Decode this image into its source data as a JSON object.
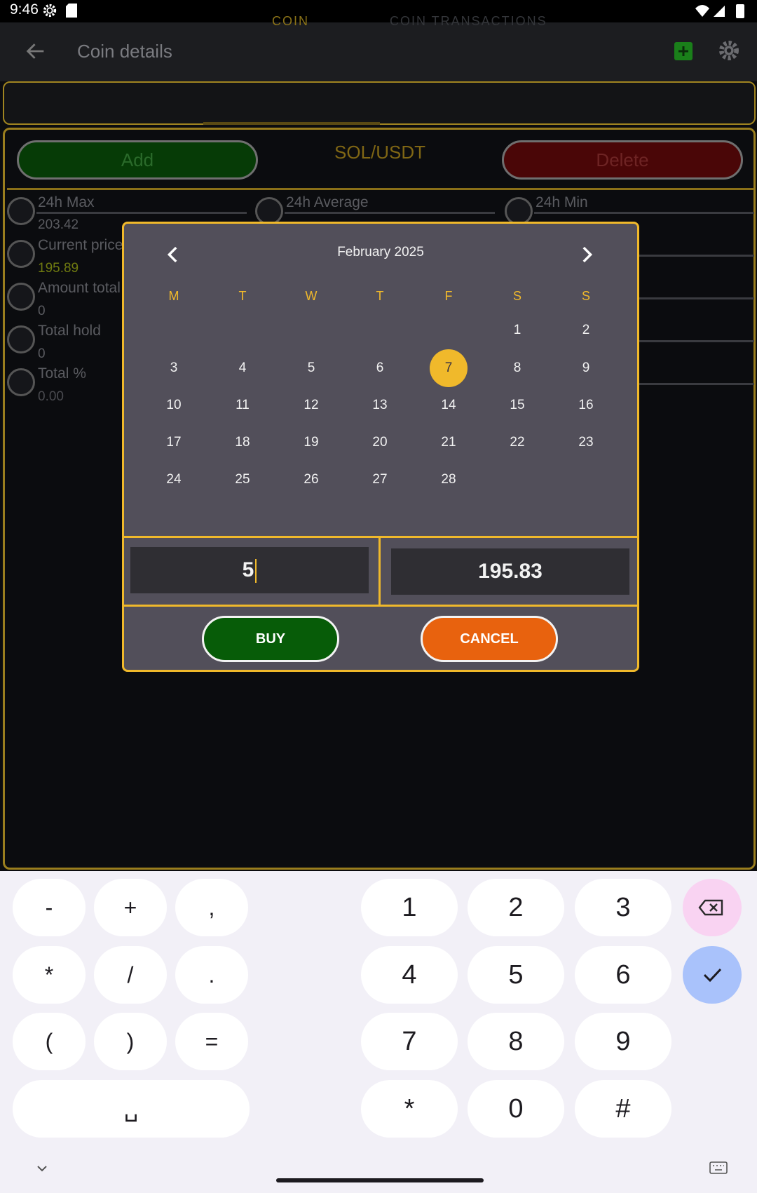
{
  "status_bar": {
    "time": "9:46"
  },
  "app_bar": {
    "title": "Coin details"
  },
  "tabs": [
    {
      "label": "COIN",
      "active": true
    },
    {
      "label": "COIN TRANSACTIONS",
      "active": false
    }
  ],
  "coin": {
    "add_label": "Add",
    "pair": "SOL/USDT",
    "delete_label": "Delete",
    "stats": {
      "max_label": "24h Max",
      "max_value": "203.42",
      "avg_label": "24h Average",
      "min_label": "24h Min",
      "current_label": "Current price",
      "current_value": "195.89",
      "amount_label": "Amount total",
      "amount_value": "0",
      "hold_label": "Total hold",
      "hold_value": "0",
      "percent_label": "Total %",
      "percent_value": "0.00"
    }
  },
  "dialog": {
    "month": "February 2025",
    "weekdays": [
      "M",
      "T",
      "W",
      "T",
      "F",
      "S",
      "S"
    ],
    "selected_day": "7",
    "days": [
      [
        "",
        "",
        "",
        "",
        "",
        "1",
        "2"
      ],
      [
        "3",
        "4",
        "5",
        "6",
        "7",
        "8",
        "9"
      ],
      [
        "10",
        "11",
        "12",
        "13",
        "14",
        "15",
        "16"
      ],
      [
        "17",
        "18",
        "19",
        "20",
        "21",
        "22",
        "23"
      ],
      [
        "24",
        "25",
        "26",
        "27",
        "28",
        "",
        ""
      ]
    ],
    "amount_value": "5",
    "price_value": "195.83",
    "buy_label": "BUY",
    "cancel_label": "CANCEL"
  },
  "keyboard": {
    "symbols": [
      [
        "-",
        "+",
        ","
      ],
      [
        "*",
        "/",
        "."
      ],
      [
        "(",
        ")",
        "="
      ]
    ],
    "space": "␣",
    "numbers": [
      [
        "1",
        "2",
        "3"
      ],
      [
        "4",
        "5",
        "6"
      ],
      [
        "7",
        "8",
        "9"
      ],
      [
        "*",
        "0",
        "#"
      ]
    ]
  },
  "colors": {
    "accent": "#f0b92b",
    "buy": "#075c08",
    "cancel": "#e8620e",
    "dialog_bg": "#524f5a"
  }
}
